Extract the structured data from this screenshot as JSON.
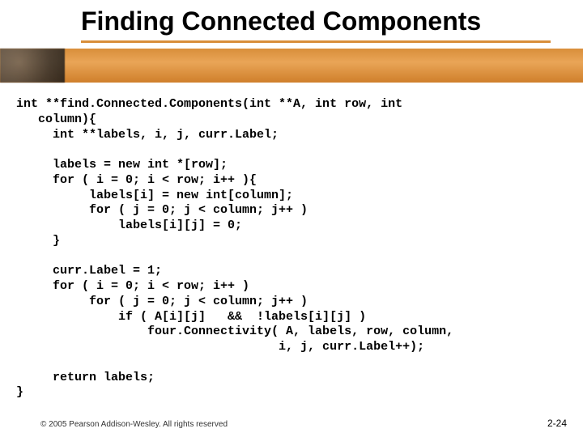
{
  "slide": {
    "title": "Finding Connected Components",
    "copyright": "© 2005 Pearson Addison-Wesley. All rights reserved",
    "page_number": "2-24"
  },
  "code": {
    "lines": [
      "int **find.Connected.Components(int **A, int row, int",
      "   column){",
      "     int **labels, i, j, curr.Label;",
      "",
      "     labels = new int *[row];",
      "     for ( i = 0; i < row; i++ ){",
      "          labels[i] = new int[column];",
      "          for ( j = 0; j < column; j++ )",
      "              labels[i][j] = 0;",
      "     }",
      "",
      "     curr.Label = 1;",
      "     for ( i = 0; i < row; i++ )",
      "          for ( j = 0; j < column; j++ )",
      "              if ( A[i][j]   &&  !labels[i][j] )",
      "                  four.Connectivity( A, labels, row, column,",
      "                                    i, j, curr.Label++);",
      "",
      "     return labels;",
      "}"
    ]
  }
}
